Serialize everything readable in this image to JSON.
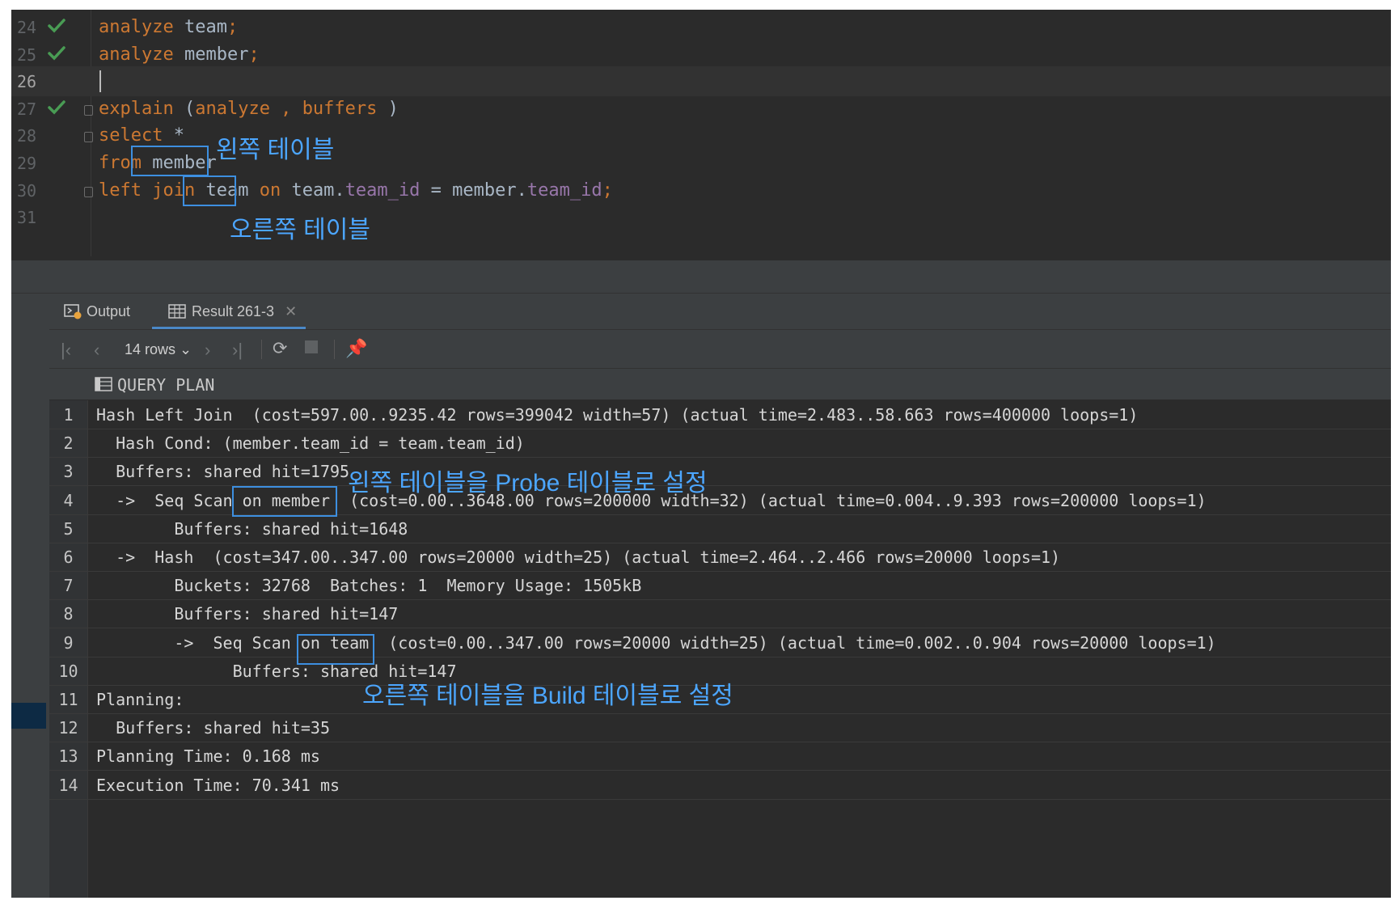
{
  "editor": {
    "lines": [
      {
        "num": "24",
        "parts": [
          {
            "t": "analyze",
            "c": "kw"
          },
          {
            "t": " team",
            "c": ""
          },
          {
            "t": ";",
            "c": "kw"
          }
        ]
      },
      {
        "num": "25",
        "parts": [
          {
            "t": "analyze",
            "c": "kw"
          },
          {
            "t": " member",
            "c": ""
          },
          {
            "t": ";",
            "c": "kw"
          }
        ]
      },
      {
        "num": "26",
        "parts": []
      },
      {
        "num": "27",
        "parts": [
          {
            "t": "explain",
            "c": "kw"
          },
          {
            "t": " (",
            "c": ""
          },
          {
            "t": "analyze",
            "c": "kw"
          },
          {
            "t": " , ",
            "c": "kw"
          },
          {
            "t": "buffers",
            "c": "kw"
          },
          {
            "t": " )",
            "c": ""
          }
        ]
      },
      {
        "num": "28",
        "parts": [
          {
            "t": "select",
            "c": "kw"
          },
          {
            "t": " *",
            "c": ""
          }
        ]
      },
      {
        "num": "29",
        "parts": [
          {
            "t": "from",
            "c": "kw"
          },
          {
            "t": " member",
            "c": ""
          }
        ]
      },
      {
        "num": "30",
        "parts": [
          {
            "t": "left",
            "c": "kw"
          },
          {
            "t": " ",
            "c": ""
          },
          {
            "t": "join",
            "c": "kw"
          },
          {
            "t": " team ",
            "c": ""
          },
          {
            "t": "on",
            "c": "kw"
          },
          {
            "t": " team.",
            "c": ""
          },
          {
            "t": "team_id",
            "c": "fld"
          },
          {
            "t": " = member.",
            "c": ""
          },
          {
            "t": "team_id",
            "c": "fld"
          },
          {
            "t": ";",
            "c": "kw"
          }
        ]
      },
      {
        "num": "31",
        "parts": []
      }
    ]
  },
  "annotations": {
    "left_table": "왼쪽 테이블",
    "right_table": "오른쪽 테이블",
    "probe": "왼쪽 테이블을 Probe 테이블로 설정",
    "build": "오른쪽 테이블을 Build 테이블로 설정"
  },
  "tabs": {
    "output": "Output",
    "result": "Result 261-3"
  },
  "toolbar": {
    "rows": "14 rows"
  },
  "grid": {
    "column": "QUERY PLAN",
    "rows": [
      "Hash Left Join  (cost=597.00..9235.42 rows=399042 width=57) (actual time=2.483..58.663 rows=400000 loops=1)",
      "  Hash Cond: (member.team_id = team.team_id)",
      "  Buffers: shared hit=1795",
      "  ->  Seq Scan on member  (cost=0.00..3648.00 rows=200000 width=32) (actual time=0.004..9.393 rows=200000 loops=1)",
      "        Buffers: shared hit=1648",
      "  ->  Hash  (cost=347.00..347.00 rows=20000 width=25) (actual time=2.464..2.466 rows=20000 loops=1)",
      "        Buckets: 32768  Batches: 1  Memory Usage: 1505kB",
      "        Buffers: shared hit=147",
      "        ->  Seq Scan on team  (cost=0.00..347.00 rows=20000 width=25) (actual time=0.002..0.904 rows=20000 loops=1)",
      "              Buffers: shared hit=147",
      "Planning:",
      "  Buffers: shared hit=35",
      "Planning Time: 0.168 ms",
      "Execution Time: 70.341 ms"
    ]
  }
}
